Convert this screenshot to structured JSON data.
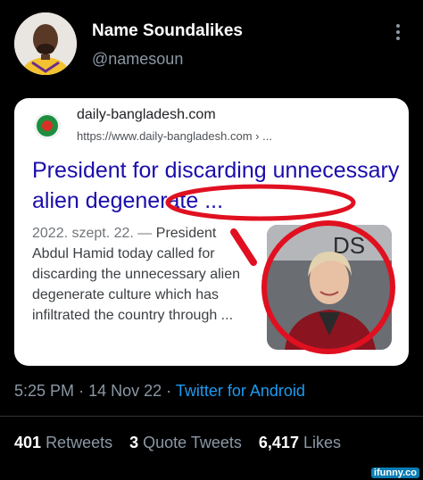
{
  "tweet": {
    "display_name": "Name Soundalikes",
    "handle": "@namesoun",
    "more_icon": "more-vertical-icon",
    "time": "5:25 PM",
    "date": "14 Nov 22",
    "client": "Twitter for Android",
    "separator": "·",
    "stats": [
      {
        "count": "401",
        "label": "Retweets"
      },
      {
        "count": "3",
        "label": "Quote Tweets"
      },
      {
        "count": "6,417",
        "label": "Likes"
      }
    ]
  },
  "search_result": {
    "site_name": "daily-bangladesh.com",
    "site_url": "https://www.daily-bangladesh.com › ...",
    "title": "President for discarding unnecessary alien degenerate ...",
    "date": "2022. szept. 22. —",
    "snippet": "President Abdul Hamid today called for discarding the unnecessary alien degenerate culture which has infiltrated the country through ...",
    "image_text": "DS"
  },
  "colors": {
    "background": "#000000",
    "link_blue": "#1a0dab",
    "twitter_blue": "#1d9bf0",
    "annotation_red": "#e01020",
    "muted": "#8b98a5"
  },
  "watermark": "ifunny.co"
}
